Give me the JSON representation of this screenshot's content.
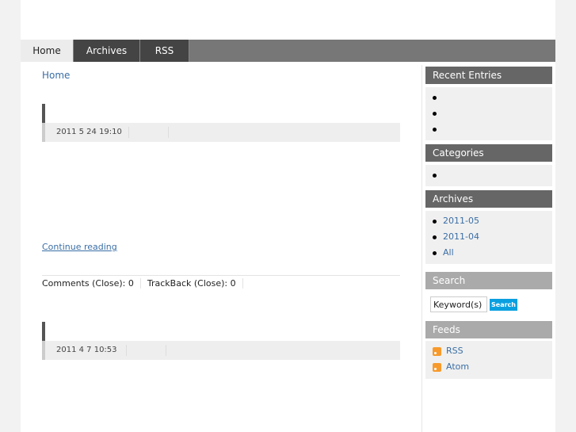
{
  "nav": {
    "items": [
      "Home",
      "Archives",
      "RSS"
    ]
  },
  "breadcrumb": "Home",
  "entries": [
    {
      "date": "2011 5 24  19:10"
    },
    {
      "date": "2011 4  7  10:53"
    }
  ],
  "continue_label": "Continue reading",
  "feedback": {
    "comments": "Comments (Close): 0",
    "trackback": "TrackBack (Close): 0"
  },
  "sidebar": {
    "recent_entries_title": "Recent Entries",
    "categories_title": "Categories",
    "archives_title": "Archives",
    "archives": [
      "2011-05",
      "2011-04",
      "All"
    ],
    "search_title": "Search",
    "search_placeholder": "Keyword(s)",
    "search_button": "Search",
    "feeds_title": "Feeds",
    "feeds": [
      "RSS",
      "Atom"
    ]
  }
}
